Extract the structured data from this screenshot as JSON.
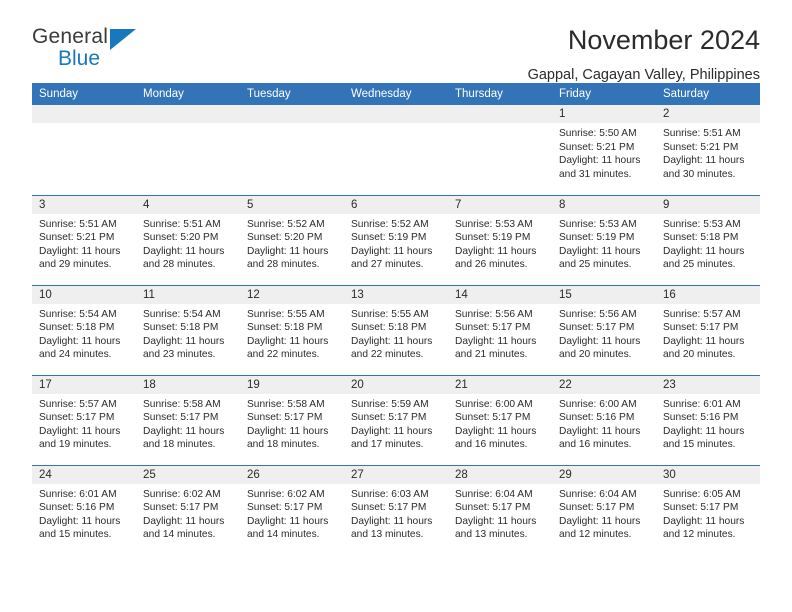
{
  "brand": {
    "name_top": "General",
    "name_bottom": "Blue"
  },
  "header": {
    "title": "November 2024",
    "subtitle": "Gappal, Cagayan Valley, Philippines"
  },
  "theme": {
    "header_blue": "#3274b7",
    "daynum_gray": "#efefef",
    "text": "#2b2b2b",
    "logo_blue": "#1878be"
  },
  "calendar": {
    "weekdays": [
      "Sunday",
      "Monday",
      "Tuesday",
      "Wednesday",
      "Thursday",
      "Friday",
      "Saturday"
    ],
    "labels": {
      "sunrise": "Sunrise:",
      "sunset": "Sunset:",
      "daylight": "Daylight:"
    },
    "weeks": [
      [
        {
          "day": "",
          "empty": true
        },
        {
          "day": "",
          "empty": true
        },
        {
          "day": "",
          "empty": true
        },
        {
          "day": "",
          "empty": true
        },
        {
          "day": "",
          "empty": true
        },
        {
          "day": "1",
          "sunrise": "Sunrise: 5:50 AM",
          "sunset": "Sunset: 5:21 PM",
          "daylight": "Daylight: 11 hours and 31 minutes."
        },
        {
          "day": "2",
          "sunrise": "Sunrise: 5:51 AM",
          "sunset": "Sunset: 5:21 PM",
          "daylight": "Daylight: 11 hours and 30 minutes."
        }
      ],
      [
        {
          "day": "3",
          "sunrise": "Sunrise: 5:51 AM",
          "sunset": "Sunset: 5:21 PM",
          "daylight": "Daylight: 11 hours and 29 minutes."
        },
        {
          "day": "4",
          "sunrise": "Sunrise: 5:51 AM",
          "sunset": "Sunset: 5:20 PM",
          "daylight": "Daylight: 11 hours and 28 minutes."
        },
        {
          "day": "5",
          "sunrise": "Sunrise: 5:52 AM",
          "sunset": "Sunset: 5:20 PM",
          "daylight": "Daylight: 11 hours and 28 minutes."
        },
        {
          "day": "6",
          "sunrise": "Sunrise: 5:52 AM",
          "sunset": "Sunset: 5:19 PM",
          "daylight": "Daylight: 11 hours and 27 minutes."
        },
        {
          "day": "7",
          "sunrise": "Sunrise: 5:53 AM",
          "sunset": "Sunset: 5:19 PM",
          "daylight": "Daylight: 11 hours and 26 minutes."
        },
        {
          "day": "8",
          "sunrise": "Sunrise: 5:53 AM",
          "sunset": "Sunset: 5:19 PM",
          "daylight": "Daylight: 11 hours and 25 minutes."
        },
        {
          "day": "9",
          "sunrise": "Sunrise: 5:53 AM",
          "sunset": "Sunset: 5:18 PM",
          "daylight": "Daylight: 11 hours and 25 minutes."
        }
      ],
      [
        {
          "day": "10",
          "sunrise": "Sunrise: 5:54 AM",
          "sunset": "Sunset: 5:18 PM",
          "daylight": "Daylight: 11 hours and 24 minutes."
        },
        {
          "day": "11",
          "sunrise": "Sunrise: 5:54 AM",
          "sunset": "Sunset: 5:18 PM",
          "daylight": "Daylight: 11 hours and 23 minutes."
        },
        {
          "day": "12",
          "sunrise": "Sunrise: 5:55 AM",
          "sunset": "Sunset: 5:18 PM",
          "daylight": "Daylight: 11 hours and 22 minutes."
        },
        {
          "day": "13",
          "sunrise": "Sunrise: 5:55 AM",
          "sunset": "Sunset: 5:18 PM",
          "daylight": "Daylight: 11 hours and 22 minutes."
        },
        {
          "day": "14",
          "sunrise": "Sunrise: 5:56 AM",
          "sunset": "Sunset: 5:17 PM",
          "daylight": "Daylight: 11 hours and 21 minutes."
        },
        {
          "day": "15",
          "sunrise": "Sunrise: 5:56 AM",
          "sunset": "Sunset: 5:17 PM",
          "daylight": "Daylight: 11 hours and 20 minutes."
        },
        {
          "day": "16",
          "sunrise": "Sunrise: 5:57 AM",
          "sunset": "Sunset: 5:17 PM",
          "daylight": "Daylight: 11 hours and 20 minutes."
        }
      ],
      [
        {
          "day": "17",
          "sunrise": "Sunrise: 5:57 AM",
          "sunset": "Sunset: 5:17 PM",
          "daylight": "Daylight: 11 hours and 19 minutes."
        },
        {
          "day": "18",
          "sunrise": "Sunrise: 5:58 AM",
          "sunset": "Sunset: 5:17 PM",
          "daylight": "Daylight: 11 hours and 18 minutes."
        },
        {
          "day": "19",
          "sunrise": "Sunrise: 5:58 AM",
          "sunset": "Sunset: 5:17 PM",
          "daylight": "Daylight: 11 hours and 18 minutes."
        },
        {
          "day": "20",
          "sunrise": "Sunrise: 5:59 AM",
          "sunset": "Sunset: 5:17 PM",
          "daylight": "Daylight: 11 hours and 17 minutes."
        },
        {
          "day": "21",
          "sunrise": "Sunrise: 6:00 AM",
          "sunset": "Sunset: 5:17 PM",
          "daylight": "Daylight: 11 hours and 16 minutes."
        },
        {
          "day": "22",
          "sunrise": "Sunrise: 6:00 AM",
          "sunset": "Sunset: 5:16 PM",
          "daylight": "Daylight: 11 hours and 16 minutes."
        },
        {
          "day": "23",
          "sunrise": "Sunrise: 6:01 AM",
          "sunset": "Sunset: 5:16 PM",
          "daylight": "Daylight: 11 hours and 15 minutes."
        }
      ],
      [
        {
          "day": "24",
          "sunrise": "Sunrise: 6:01 AM",
          "sunset": "Sunset: 5:16 PM",
          "daylight": "Daylight: 11 hours and 15 minutes."
        },
        {
          "day": "25",
          "sunrise": "Sunrise: 6:02 AM",
          "sunset": "Sunset: 5:17 PM",
          "daylight": "Daylight: 11 hours and 14 minutes."
        },
        {
          "day": "26",
          "sunrise": "Sunrise: 6:02 AM",
          "sunset": "Sunset: 5:17 PM",
          "daylight": "Daylight: 11 hours and 14 minutes."
        },
        {
          "day": "27",
          "sunrise": "Sunrise: 6:03 AM",
          "sunset": "Sunset: 5:17 PM",
          "daylight": "Daylight: 11 hours and 13 minutes."
        },
        {
          "day": "28",
          "sunrise": "Sunrise: 6:04 AM",
          "sunset": "Sunset: 5:17 PM",
          "daylight": "Daylight: 11 hours and 13 minutes."
        },
        {
          "day": "29",
          "sunrise": "Sunrise: 6:04 AM",
          "sunset": "Sunset: 5:17 PM",
          "daylight": "Daylight: 11 hours and 12 minutes."
        },
        {
          "day": "30",
          "sunrise": "Sunrise: 6:05 AM",
          "sunset": "Sunset: 5:17 PM",
          "daylight": "Daylight: 11 hours and 12 minutes."
        }
      ]
    ]
  }
}
